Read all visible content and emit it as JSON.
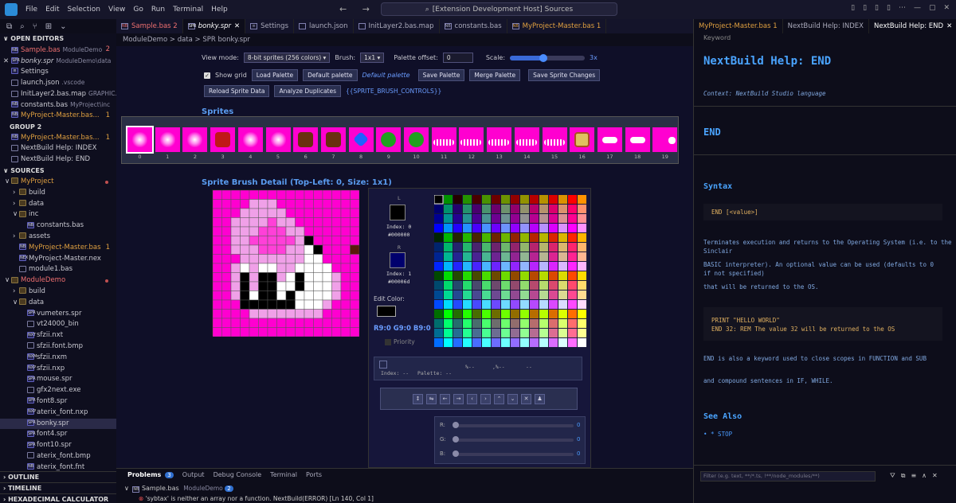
{
  "titlebar": {
    "menu": [
      "File",
      "Edit",
      "Selection",
      "View",
      "Go",
      "Run",
      "Terminal",
      "Help"
    ],
    "nav": "← →",
    "search": "[Extension Development Host] Sources",
    "controls": [
      "▯",
      "▯",
      "▯",
      "▯",
      "⋯",
      "—",
      "▢",
      "✕"
    ]
  },
  "activity": [
    "⧉",
    "⌕",
    "⑂",
    "⊞",
    "⌄"
  ],
  "sidebar": {
    "open_editors": "∨ OPEN EDITORS",
    "group2": "GROUP 2",
    "sources": "∨ SOURCES",
    "outline": "› OUTLINE",
    "timeline": "› TIMELINE",
    "hexcalc": "› HEXADECIMAL CALCULATOR",
    "open": [
      {
        "ico": "NB",
        "name": "Sample.bas",
        "desc": "ModuleDemo",
        "badge": "2",
        "cls": "red"
      },
      {
        "ico": "SPR",
        "name": "bonky.spr",
        "desc": "ModuleDemo\\data",
        "badge": "",
        "cls": "",
        "x": "✕"
      },
      {
        "ico": "≡",
        "name": "Settings",
        "desc": "",
        "badge": "",
        "cls": ""
      },
      {
        "ico": "",
        "name": "launch.json",
        "desc": ".vscode",
        "badge": "",
        "cls": ""
      },
      {
        "ico": "",
        "name": "InitLayer2.bas.map",
        "desc": "GRAPHIC...",
        "badge": "",
        "cls": ""
      },
      {
        "ico": "NB",
        "name": "constants.bas",
        "desc": "MyProject\\inc",
        "badge": "",
        "cls": ""
      },
      {
        "ico": "NB",
        "name": "MyProject-Master.bas...",
        "desc": "",
        "badge": "1",
        "cls": "orange"
      }
    ],
    "group2_items": [
      {
        "ico": "NB",
        "name": "MyProject-Master.bas...",
        "badge": "1",
        "cls": "orange"
      },
      {
        "ico": "",
        "name": "NextBuild Help: INDEX",
        "badge": "",
        "cls": ""
      },
      {
        "ico": "",
        "name": "NextBuild Help: END",
        "badge": "",
        "cls": ""
      }
    ],
    "tree": [
      {
        "d": 0,
        "arrow": "∨",
        "folder": true,
        "name": "MyProject",
        "cls": "orange",
        "dot": true
      },
      {
        "d": 1,
        "arrow": "›",
        "folder": true,
        "name": "build",
        "cls": ""
      },
      {
        "d": 1,
        "arrow": "›",
        "folder": true,
        "name": "data",
        "cls": ""
      },
      {
        "d": 1,
        "arrow": "∨",
        "folder": true,
        "name": "inc",
        "cls": ""
      },
      {
        "d": 2,
        "arrow": "",
        "ico": "NB",
        "name": "constants.bas",
        "cls": ""
      },
      {
        "d": 1,
        "arrow": "›",
        "folder": true,
        "name": "assets",
        "cls": ""
      },
      {
        "d": 1,
        "arrow": "",
        "ico": "NB",
        "name": "MyProject-Master.bas",
        "cls": "orange",
        "badge": "1"
      },
      {
        "d": 1,
        "arrow": "",
        "ico": "NEX",
        "name": "MyProject-Master.nex",
        "cls": ""
      },
      {
        "d": 1,
        "arrow": "",
        "ico": "",
        "name": "module1.bas",
        "cls": ""
      },
      {
        "d": 0,
        "arrow": "∨",
        "folder": true,
        "name": "ModuleDemo",
        "cls": "red",
        "dot": true
      },
      {
        "d": 1,
        "arrow": "›",
        "folder": true,
        "name": "build",
        "cls": ""
      },
      {
        "d": 1,
        "arrow": "∨",
        "folder": true,
        "name": "data",
        "cls": ""
      },
      {
        "d": 2,
        "arrow": "",
        "ico": "SPR",
        "name": "vumeters.spr",
        "cls": ""
      },
      {
        "d": 2,
        "arrow": "",
        "ico": "",
        "name": "vt24000_bin",
        "cls": ""
      },
      {
        "d": 2,
        "arrow": "",
        "ico": "NXT",
        "name": "sfzii.nxt",
        "cls": ""
      },
      {
        "d": 2,
        "arrow": "",
        "ico": "",
        "name": "sfzii.font.bmp",
        "cls": ""
      },
      {
        "d": 2,
        "arrow": "",
        "ico": "NXM",
        "name": "sfzii.nxm",
        "cls": ""
      },
      {
        "d": 2,
        "arrow": "",
        "ico": "NXP",
        "name": "sfzii.nxp",
        "cls": ""
      },
      {
        "d": 2,
        "arrow": "",
        "ico": "SPR",
        "name": "mouse.spr",
        "cls": ""
      },
      {
        "d": 2,
        "arrow": "",
        "ico": "",
        "name": "gfx2next.exe",
        "cls": ""
      },
      {
        "d": 2,
        "arrow": "",
        "ico": "SPR",
        "name": "font8.spr",
        "cls": ""
      },
      {
        "d": 2,
        "arrow": "",
        "ico": "NXP",
        "name": "aterix_font.nxp",
        "cls": ""
      },
      {
        "d": 2,
        "arrow": "",
        "ico": "SPR",
        "name": "bonky.spr",
        "cls": "",
        "sel": true
      },
      {
        "d": 2,
        "arrow": "",
        "ico": "SPR",
        "name": "font4.spr",
        "cls": ""
      },
      {
        "d": 2,
        "arrow": "",
        "ico": "SPR",
        "name": "font10.spr",
        "cls": ""
      },
      {
        "d": 2,
        "arrow": "",
        "ico": "",
        "name": "aterix_font.bmp",
        "cls": ""
      },
      {
        "d": 2,
        "arrow": "",
        "ico": "NB",
        "name": "aterix_font.fnt",
        "cls": ""
      }
    ]
  },
  "tabs": [
    {
      "ico": "NB",
      "label": "Sample.bas 2",
      "cls": "err"
    },
    {
      "ico": "SPR",
      "label": "bonky.spr",
      "cls": "",
      "active": true,
      "x": "✕"
    },
    {
      "ico": "≡",
      "label": "Settings",
      "cls": ""
    },
    {
      "ico": "",
      "label": "launch.json",
      "cls": ""
    },
    {
      "ico": "",
      "label": "InitLayer2.bas.map",
      "cls": ""
    },
    {
      "ico": "NB",
      "label": "constants.bas",
      "cls": ""
    },
    {
      "ico": "NB",
      "label": "MyProject-Master.bas 1",
      "cls": "warn"
    }
  ],
  "breadcrumb": "ModuleDemo > data > SPR bonky.spr",
  "editor": {
    "view_mode_label": "View mode:",
    "view_mode_value": "8-bit sprites (256 colors) ▾",
    "brush_label": "Brush:",
    "brush_value": "1x1 ▾",
    "palette_offset_label": "Palette offset:",
    "palette_offset_value": "0",
    "scale_label": "Scale:",
    "scale_value": "3x",
    "scale_fraction": 0.45,
    "show_grid_label": "Show grid",
    "btn_load_palette": "Load Palette",
    "btn_default_palette": "Default palette",
    "link_default_palette": "Default palette",
    "btn_save_palette": "Save Palette",
    "btn_merge_palette": "Merge Palette",
    "btn_save_sprites": "Save Sprite Changes",
    "btn_reload": "Reload Sprite Data",
    "btn_analyze": "Analyze Duplicates",
    "brush_controls": "{{SPRITE_BRUSH_CONTROLS}}",
    "sprites_title": "Sprites",
    "sprite_indices": [
      "0",
      "1",
      "2",
      "3",
      "4",
      "5",
      "6",
      "7",
      "8",
      "9",
      "10",
      "11",
      "12",
      "13",
      "14",
      "15",
      "16",
      "17",
      "18",
      "19"
    ],
    "detail_title": "Sprite Brush Detail (Top-Left: 0, Size: 1x1)"
  },
  "palette": {
    "L": "L",
    "R": "R",
    "idx0": "Index: 0",
    "hex0": "#000000",
    "idx1": "Index: 1",
    "hex1": "#00006d",
    "edit_color": "Edit Color:",
    "rgb": "R9:0  G9:0  B9:0",
    "priority": "Priority",
    "info_index": "Index: --",
    "info_palette": "Palette: --",
    "info_a": "%--",
    "info_b": ",%--",
    "info_c": "--",
    "tools": [
      "↕",
      "⇋",
      "←",
      "→",
      "‹",
      "›",
      "⌃",
      "⌄",
      "✕",
      "♟"
    ],
    "sliders": [
      "R:",
      "G:",
      "B:"
    ],
    "slider_vals": [
      "0",
      "0",
      "0"
    ]
  },
  "panel": {
    "tabs": [
      "Problems",
      "Output",
      "Debug Console",
      "Terminal",
      "Ports"
    ],
    "problems_count": "3",
    "file": "Sample.bas",
    "file_desc": "ModuleDemo",
    "file_count": "2",
    "error": "'sybtax' is neither an array nor a function.  NextBuild(ERROR)  [Ln 140, Col 1]"
  },
  "help": {
    "tabs": [
      {
        "label": "MyProject-Master.bas 1",
        "cls": "warn"
      },
      {
        "label": "NextBuild Help: INDEX",
        "cls": ""
      },
      {
        "label": "NextBuild Help: END",
        "cls": "",
        "x": "✕"
      }
    ],
    "keyword": "Keyword",
    "title": "NextBuild Help: END",
    "context": "Context: NextBuild Studio language",
    "end": "END",
    "syntax": "Syntax",
    "syntax_code": "END [<value>]",
    "desc1": "Terminates execution and returns to the Operating System (i.e. to the Sinclair",
    "desc2": "BASIC interpreter). An optional value can be used (defaults to 0 if not specified)",
    "desc3": "that will be returned to the OS.",
    "ex1": "PRINT \"HELLO WORLD\"",
    "ex2": "END 32: REM The value 32 will be returned to the OS",
    "note1": " END  is also a keyword used to close scopes in FUNCTION and SUB",
    "note2": "and compound sentences in IF, WHILE.",
    "see_also": "See Also",
    "see_item": "• * STOP",
    "filter": "Filter (e.g. text, **/*.ts, !**/node_modules/**)",
    "filter_icons": [
      "⛛",
      "⧉",
      "≡",
      "∧",
      "✕"
    ]
  }
}
